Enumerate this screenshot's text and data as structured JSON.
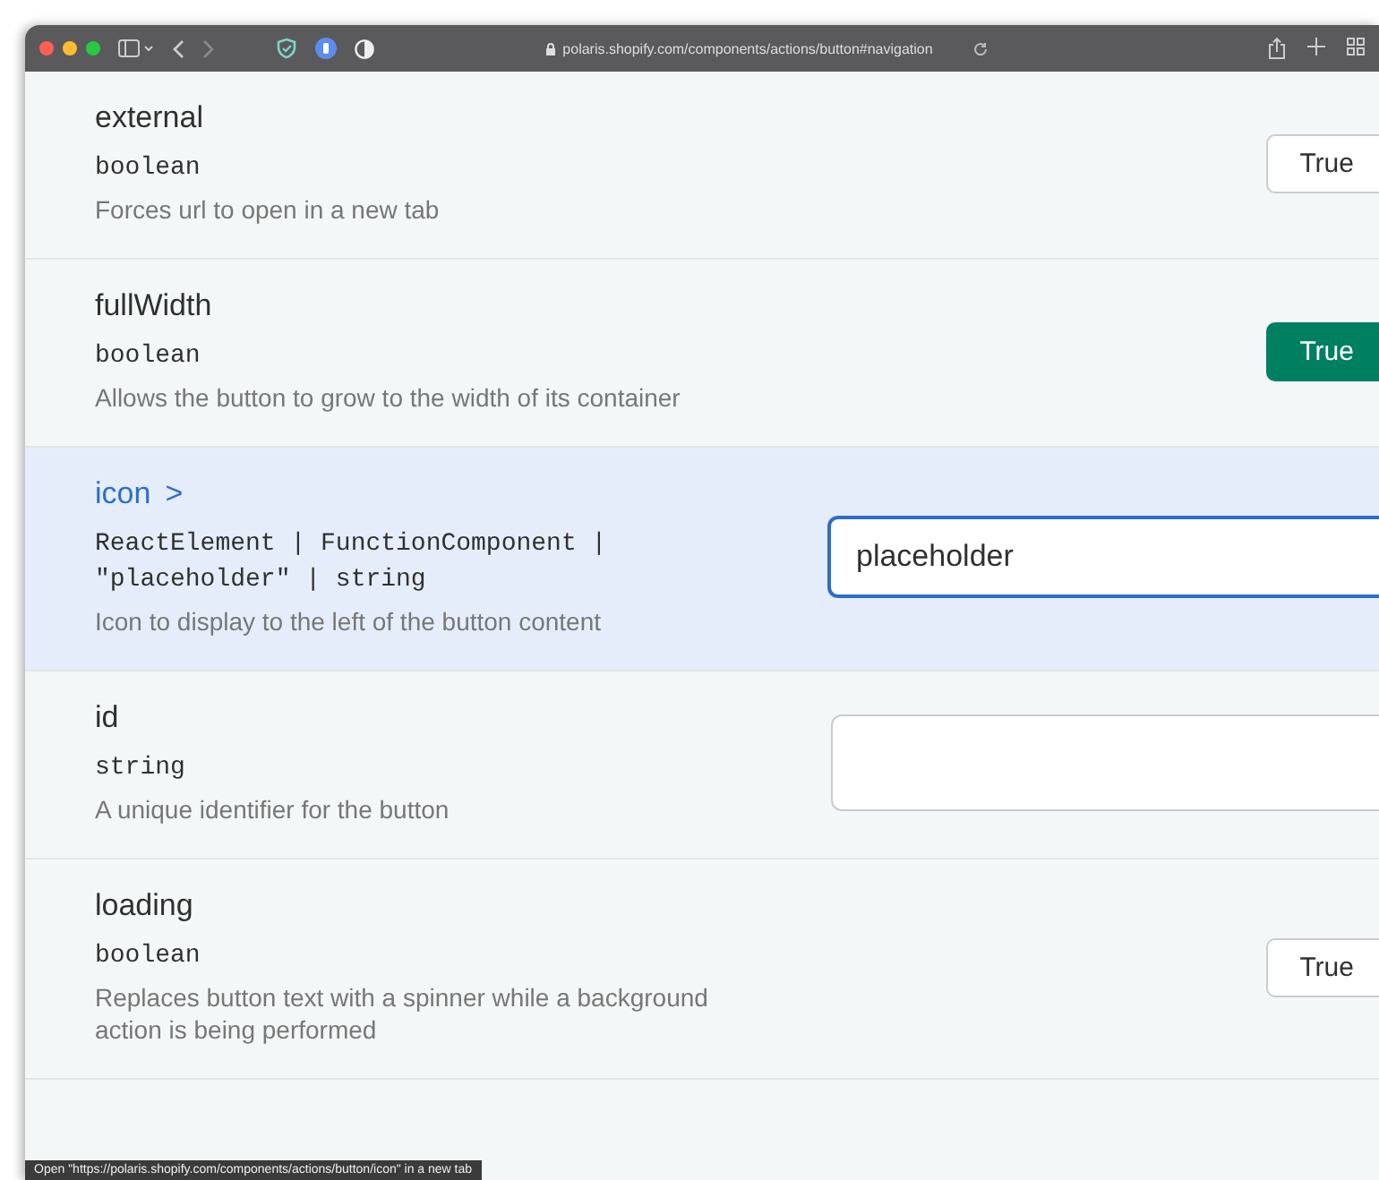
{
  "browser": {
    "url": "polaris.shopify.com/components/actions/button#navigation"
  },
  "props": [
    {
      "name": "external",
      "kind": "plain",
      "type": "boolean",
      "description": "Forces url to open in a new tab",
      "control": {
        "kind": "toggle",
        "label": "True",
        "on": false
      },
      "hovered": false
    },
    {
      "name": "fullWidth",
      "kind": "plain",
      "type": "boolean",
      "description": "Allows the button to grow to the width of its container",
      "control": {
        "kind": "toggle",
        "label": "True",
        "on": true
      },
      "hovered": false
    },
    {
      "name": "icon",
      "kind": "link",
      "chevron": ">",
      "type": "ReactElement | FunctionComponent | \"placeholder\" | string",
      "description": "Icon to display to the left of the button content",
      "control": {
        "kind": "input",
        "value": "placeholder",
        "focused": true
      },
      "hovered": true
    },
    {
      "name": "id",
      "kind": "plain",
      "type": "string",
      "description": "A unique identifier for the button",
      "control": {
        "kind": "input",
        "focused": false
      },
      "hovered": false
    },
    {
      "name": "loading",
      "kind": "plain",
      "type": "boolean",
      "description": "Replaces button text with a spinner while a background action is being performed",
      "control": {
        "kind": "toggle",
        "label": "True",
        "on": false
      },
      "hovered": false
    }
  ],
  "status_bar": "Open \"https://polaris.shopify.com/components/actions/button/icon\" in a new tab"
}
